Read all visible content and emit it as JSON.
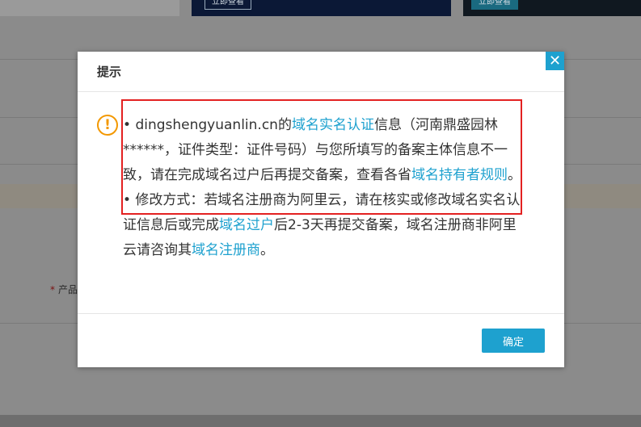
{
  "background": {
    "banner_buttons": [
      "立即查看",
      "立即查看"
    ],
    "form_label": "产品"
  },
  "dialog": {
    "title": "提示",
    "close_symbol": "✕",
    "warning_symbol": "!",
    "paragraph1": {
      "bullet": "• ",
      "domain": "dingshengyuanlin.cn的",
      "link1": "域名实名认证",
      "text1": "信息（河南鼎盛园林******，证件类型：证件号码）与您所填写的备案主体信息不一致，请在完成域名过户后再提交备案，查看各省",
      "link2": "域名持有者规则",
      "end": "。"
    },
    "paragraph2": {
      "text1": "• 修改方式：若域名注册商为阿里云，请在核实或修改域名实名认证信息后或完成",
      "link1": "域名过户",
      "text2": "后2-3天再提交备案，域名注册商非阿里云请咨询其",
      "link2": "域名注册商",
      "end": "。"
    },
    "confirm_label": "确定"
  },
  "colors": {
    "accent": "#1ea1cf",
    "warning": "#f39800",
    "highlight": "#e32121"
  }
}
